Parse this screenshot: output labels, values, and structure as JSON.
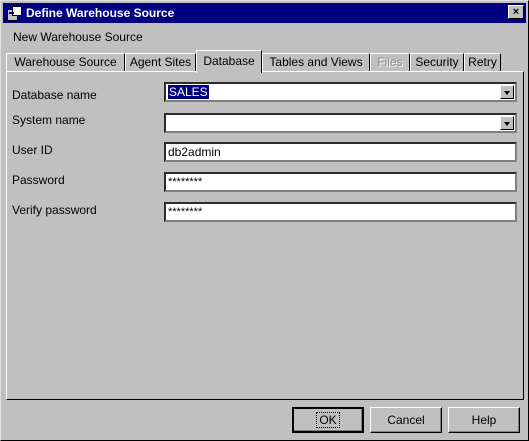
{
  "window": {
    "title": "Define Warehouse Source",
    "close_icon": "close-icon"
  },
  "subtitle": "New Warehouse Source",
  "tabs": [
    {
      "label": "Warehouse Source",
      "state": "normal"
    },
    {
      "label": "Agent Sites",
      "state": "normal"
    },
    {
      "label": "Database",
      "state": "active"
    },
    {
      "label": "Tables and Views",
      "state": "normal"
    },
    {
      "label": "Files",
      "state": "disabled"
    },
    {
      "label": "Security",
      "state": "normal"
    },
    {
      "label": "Retry",
      "state": "normal"
    }
  ],
  "form": {
    "database_name": {
      "label": "Database name",
      "value": "SALES"
    },
    "system_name": {
      "label": "System name",
      "value": ""
    },
    "user_id": {
      "label": "User ID",
      "value": "db2admin"
    },
    "password": {
      "label": "Password",
      "value": "********"
    },
    "verify_password": {
      "label": "Verify password",
      "value": "********"
    }
  },
  "buttons": {
    "ok": "OK",
    "cancel": "Cancel",
    "help": "Help"
  },
  "colors": {
    "titlebar": "#000080",
    "face": "#c0c0c0",
    "selection": "#000080"
  }
}
